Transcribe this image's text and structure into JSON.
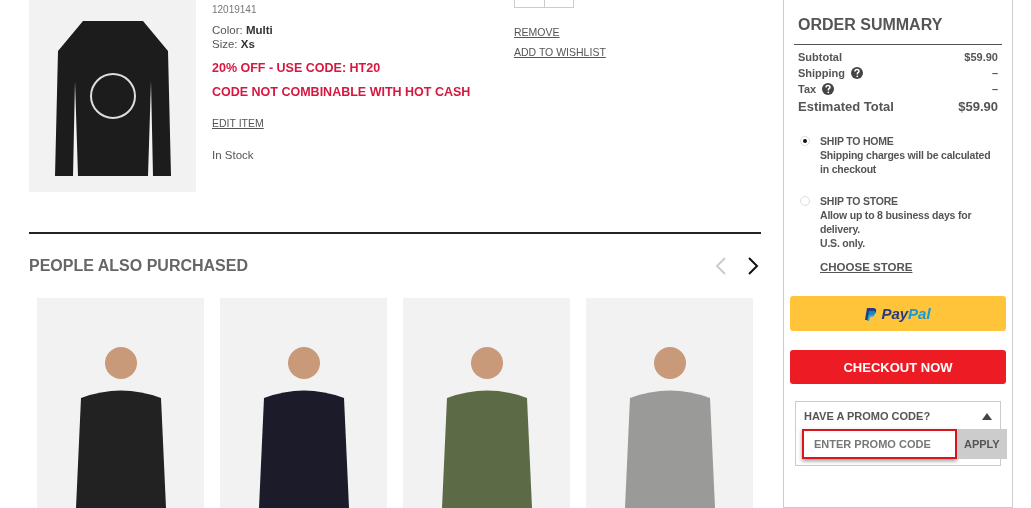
{
  "cart_item": {
    "sku": "12019141",
    "attributes": [
      {
        "label": "Color: ",
        "value": "Multi"
      },
      {
        "label": "Size: ",
        "value": "Xs"
      }
    ],
    "promos": [
      "20% OFF - USE CODE: HT20",
      "CODE NOT COMBINABLE WITH HOT CASH"
    ],
    "edit_link": "EDIT ITEM",
    "stock": "In Stock",
    "actions": [
      "REMOVE",
      "ADD TO WISHLIST"
    ]
  },
  "also_purchased": {
    "title": "PEOPLE ALSO PURCHASED",
    "prev_disabled": true,
    "products": [
      {
        "kind": "hoodie"
      },
      {
        "kind": "pants"
      },
      {
        "kind": "jacket"
      },
      {
        "kind": "sweater"
      }
    ]
  },
  "order_summary": {
    "title": "ORDER SUMMARY",
    "lines": [
      {
        "label": "Subtotal",
        "value": "$59.90",
        "help": false
      },
      {
        "label": "Shipping",
        "value": "–",
        "help": true
      },
      {
        "label": "Tax",
        "value": "–",
        "help": true
      }
    ],
    "total": {
      "label": "Estimated Total",
      "value": "$59.90"
    },
    "shipping_options": [
      {
        "title": "SHIP TO HOME",
        "lines": [
          "Shipping charges will be calculated in checkout"
        ],
        "selected": true
      },
      {
        "title": "SHIP TO STORE",
        "lines": [
          "Allow up to 8 business days for delivery.",
          "U.S. only."
        ],
        "selected": false,
        "link": "CHOOSE STORE"
      }
    ],
    "paypal_label": [
      "Pay",
      "Pal"
    ],
    "checkout": "CHECKOUT NOW",
    "promo": {
      "title": "HAVE A PROMO CODE?",
      "expanded": true,
      "placeholder": "ENTER PROMO CODE",
      "button": "APPLY"
    }
  }
}
